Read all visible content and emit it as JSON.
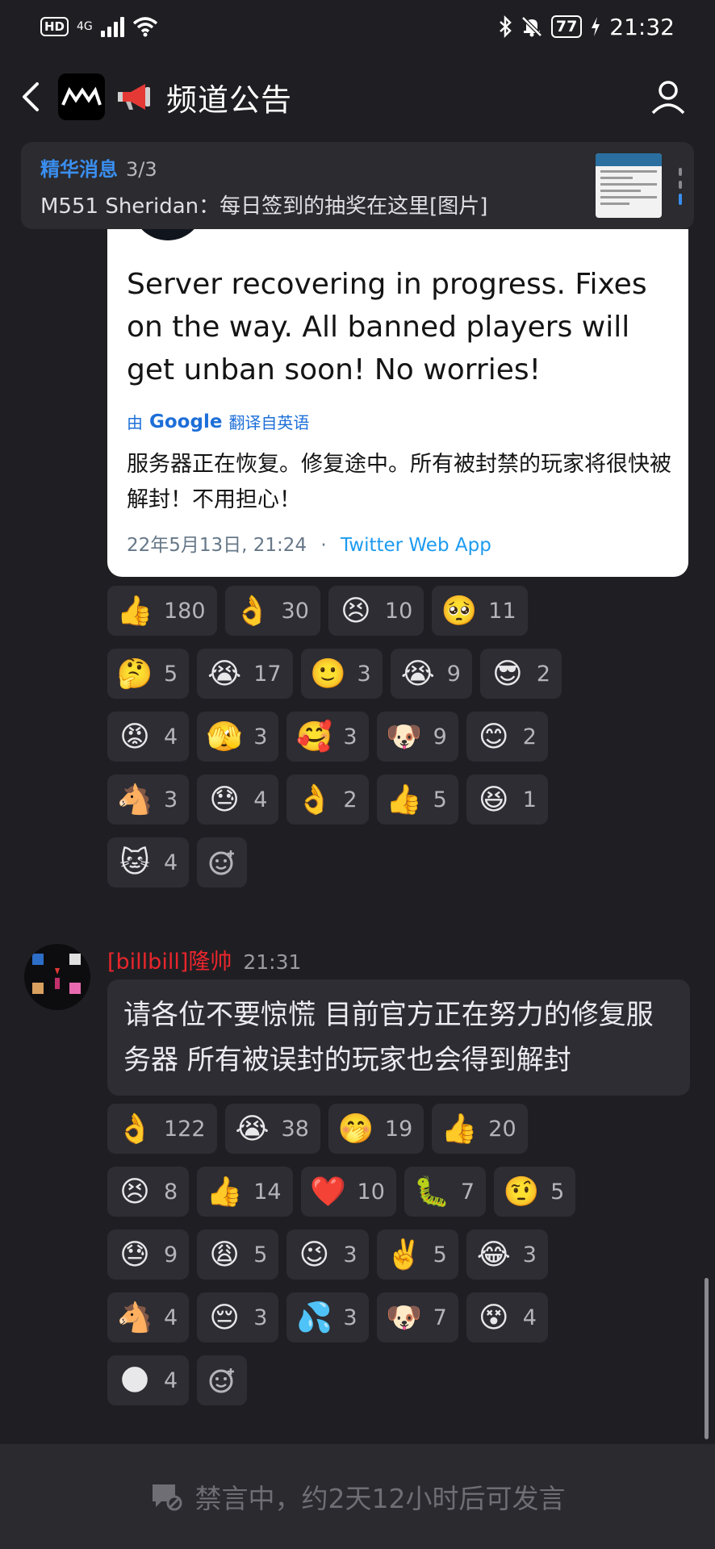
{
  "status_bar": {
    "hd": "HD",
    "network": "4G",
    "battery": "77",
    "time": "21:32"
  },
  "header": {
    "title": "频道公告",
    "logo_text": "MW"
  },
  "pinned": {
    "label": "精华消息",
    "count": "3/3",
    "text": "M551 Sheridan：每日签到的抽奖在这里[图片]"
  },
  "tweet": {
    "text": "Server recovering in progress. Fixes on the way. All banned players will get unban soon! No worries!",
    "translate_prefix": "由",
    "translate_brand": "Google",
    "translate_suffix": "翻译自英语",
    "translation": "服务器正在恢复。修复途中。所有被封禁的玩家将很快被解封！不用担心！",
    "date": "22年5月13日, 21:24",
    "separator": "·",
    "source": "Twitter Web App"
  },
  "reactions_1": [
    [
      {
        "emoji": "👍",
        "count": "180"
      },
      {
        "emoji": "👌",
        "count": "30"
      },
      {
        "emoji": "😣",
        "count": "10"
      },
      {
        "emoji": "🥺",
        "count": "11"
      }
    ],
    [
      {
        "emoji": "🤔",
        "count": "5"
      },
      {
        "emoji": "😭",
        "count": "17"
      },
      {
        "emoji": "🙂",
        "count": "3"
      },
      {
        "emoji": "😭",
        "count": "9"
      },
      {
        "emoji": "😎",
        "count": "2"
      }
    ],
    [
      {
        "emoji": "😡",
        "count": "4"
      },
      {
        "emoji": "🫣",
        "count": "3"
      },
      {
        "emoji": "🥰",
        "count": "3"
      },
      {
        "emoji": "🐶",
        "count": "9"
      },
      {
        "emoji": "😊",
        "count": "2"
      }
    ],
    [
      {
        "emoji": "🐴",
        "count": "3"
      },
      {
        "emoji": "😓",
        "count": "4"
      },
      {
        "emoji": "👌",
        "count": "2"
      },
      {
        "emoji": "👍",
        "count": "5"
      },
      {
        "emoji": "😆",
        "count": "1"
      }
    ],
    [
      {
        "emoji": "🐱",
        "count": "4"
      }
    ]
  ],
  "message": {
    "author": "[billbill]隆帅",
    "time": "21:31",
    "text": "请各位不要惊慌  目前官方正在努力的修复服务器 所有被误封的玩家也会得到解封"
  },
  "reactions_2": [
    [
      {
        "emoji": "👌",
        "count": "122"
      },
      {
        "emoji": "😭",
        "count": "38"
      },
      {
        "emoji": "🤭",
        "count": "19"
      },
      {
        "emoji": "👍",
        "count": "20"
      }
    ],
    [
      {
        "emoji": "😣",
        "count": "8"
      },
      {
        "emoji": "👍",
        "count": "14"
      },
      {
        "emoji": "❤️",
        "count": "10"
      },
      {
        "emoji": "🐛",
        "count": "7"
      },
      {
        "emoji": "🤨",
        "count": "5"
      }
    ],
    [
      {
        "emoji": "😓",
        "count": "9"
      },
      {
        "emoji": "😩",
        "count": "5"
      },
      {
        "emoji": "😉",
        "count": "3"
      },
      {
        "emoji": "✌️",
        "count": "5"
      },
      {
        "emoji": "😂",
        "count": "3"
      }
    ],
    [
      {
        "emoji": "🐴",
        "count": "4"
      },
      {
        "emoji": "😔",
        "count": "3"
      },
      {
        "emoji": "💦",
        "count": "3"
      },
      {
        "emoji": "🐶",
        "count": "7"
      },
      {
        "emoji": "😵",
        "count": "4"
      }
    ],
    [
      {
        "emoji": "🌑",
        "count": "4"
      }
    ]
  ],
  "bottom": {
    "mute_text": "禁言中，约2天12小时后可发言"
  },
  "colors": {
    "background": "#1f1f23",
    "chip": "#2d2d33",
    "pinned_label": "#3a8ff0",
    "author_name": "#e8262c",
    "twitter_link": "#1d9bf0"
  }
}
